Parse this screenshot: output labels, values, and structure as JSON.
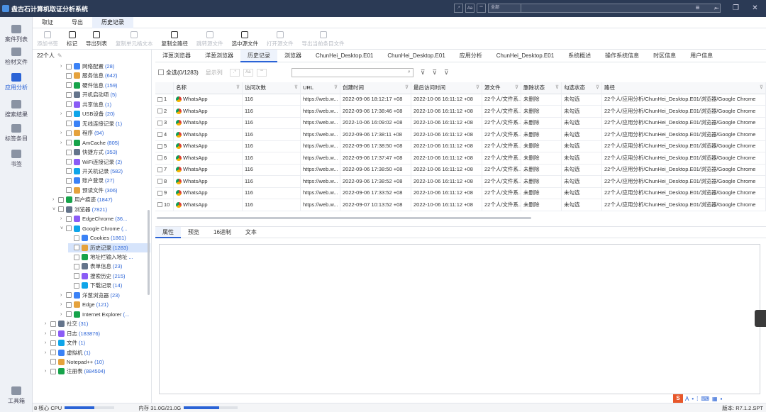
{
  "app": {
    "title": "盘古石计算机取证分析系统",
    "accent": "#2a63d6",
    "titlebar_color": "#2b3a55"
  },
  "titlebar": {
    "btn_a": ".*",
    "btn_b": "Aa",
    "btn_c": "\"\"",
    "search_scope": "全部",
    "search_value": "",
    "search_icon": "search-icon"
  },
  "rail": {
    "items": [
      {
        "label": "案件列表",
        "icon": "case-icon"
      },
      {
        "label": "检材文件",
        "icon": "layers-icon"
      },
      {
        "label": "应用分析",
        "icon": "grid-icon"
      },
      {
        "label": "搜索结果",
        "icon": "document-icon"
      },
      {
        "label": "标签条目",
        "icon": "tag-icon"
      },
      {
        "label": "书签",
        "icon": "bookmark-icon"
      },
      {
        "label": "工具箱",
        "icon": "toolbox-icon"
      }
    ]
  },
  "menu": {
    "items": [
      "取证",
      "导出",
      "历史记录"
    ],
    "active": "历史记录"
  },
  "toolbar": {
    "items": [
      {
        "label": "添加书签",
        "disabled": true
      },
      {
        "label": "标记",
        "disabled": false
      },
      {
        "label": "导出列表",
        "disabled": false
      },
      {
        "label": "复制单元格文本",
        "disabled": true
      },
      {
        "label": "复制全路径",
        "disabled": false
      },
      {
        "label": "跳转源文件",
        "disabled": true
      },
      {
        "label": "选中源文件",
        "disabled": false
      },
      {
        "label": "打开源文件",
        "disabled": true
      },
      {
        "label": "导出当前条目文件",
        "disabled": true
      }
    ]
  },
  "tree": {
    "header": "22个人",
    "nodes": [
      {
        "label": "网络配置",
        "count": "(28)",
        "indent": 3,
        "arrow": "›"
      },
      {
        "label": "服务信息",
        "count": "(642)",
        "indent": 3,
        "arrow": ""
      },
      {
        "label": "硬件信息",
        "count": "(159)",
        "indent": 3,
        "arrow": ""
      },
      {
        "label": "开机启动项",
        "count": "(5)",
        "indent": 3,
        "arrow": ""
      },
      {
        "label": "共享信息",
        "count": "(1)",
        "indent": 3,
        "arrow": ""
      },
      {
        "label": "USB设备",
        "count": "(20)",
        "indent": 3,
        "arrow": "›"
      },
      {
        "label": "无线连接记录",
        "count": "(1)",
        "indent": 3,
        "arrow": ""
      },
      {
        "label": "程序",
        "count": "(94)",
        "indent": 3,
        "arrow": "›"
      },
      {
        "label": "AmCache",
        "count": "(805)",
        "indent": 3,
        "arrow": "›"
      },
      {
        "label": "快捷方式",
        "count": "(353)",
        "indent": 3,
        "arrow": ""
      },
      {
        "label": "WiFi连接记录",
        "count": "(2)",
        "indent": 3,
        "arrow": ""
      },
      {
        "label": "开关机记录",
        "count": "(582)",
        "indent": 3,
        "arrow": ""
      },
      {
        "label": "账户登录",
        "count": "(27)",
        "indent": 3,
        "arrow": ""
      },
      {
        "label": "预读文件",
        "count": "(306)",
        "indent": 3,
        "arrow": ""
      },
      {
        "label": "用户痕迹",
        "count": "(1847)",
        "indent": 2,
        "arrow": "›"
      },
      {
        "label": "浏览器",
        "count": "(7821)",
        "indent": 2,
        "arrow": "˅"
      },
      {
        "label": "EdgeChrome",
        "count": "(36...",
        "indent": 3,
        "arrow": "›"
      },
      {
        "label": "Google Chrome",
        "count": "(...",
        "indent": 3,
        "arrow": "˅"
      },
      {
        "label": "Cookies",
        "count": "(1861)",
        "indent": 4,
        "arrow": ""
      },
      {
        "label": "历史记录",
        "count": "(1283)",
        "indent": 4,
        "arrow": "",
        "selected": true
      },
      {
        "label": "地址栏输入地址",
        "count": "...",
        "indent": 4,
        "arrow": ""
      },
      {
        "label": "表单信息",
        "count": "(23)",
        "indent": 4,
        "arrow": ""
      },
      {
        "label": "搜索历史",
        "count": "(215)",
        "indent": 4,
        "arrow": ""
      },
      {
        "label": "下载记录",
        "count": "(14)",
        "indent": 4,
        "arrow": ""
      },
      {
        "label": "洋葱浏览器",
        "count": "(23)",
        "indent": 3,
        "arrow": "›"
      },
      {
        "label": "Edge",
        "count": "(121)",
        "indent": 3,
        "arrow": "›"
      },
      {
        "label": "Internet Explorer",
        "count": "(...",
        "indent": 3,
        "arrow": "›"
      },
      {
        "label": "社交",
        "count": "(31)",
        "indent": 1,
        "arrow": "›"
      },
      {
        "label": "日志",
        "count": "(183876)",
        "indent": 1,
        "arrow": "›"
      },
      {
        "label": "文件",
        "count": "(1)",
        "indent": 1,
        "arrow": "›"
      },
      {
        "label": "虚拟机",
        "count": "(1)",
        "indent": 1,
        "arrow": "›"
      },
      {
        "label": "Notepad++",
        "count": "(10)",
        "indent": 1,
        "arrow": ""
      },
      {
        "label": "注册表",
        "count": "(884504)",
        "indent": 1,
        "arrow": "›"
      }
    ]
  },
  "tabs": {
    "items": [
      "洋葱浏览器",
      "洋葱浏览器",
      "历史记录",
      "浏览器",
      "ChunHei_Desktop.E01",
      "ChunHei_Desktop.E01",
      "应用分析",
      "ChunHei_Desktop.E01",
      "系统概述",
      "操作系统信息",
      "时区信息",
      "用户信息"
    ],
    "active_index": 2
  },
  "filterbar": {
    "select_all": "全选(0/1283)",
    "show_cols": "显示列",
    "search_value": ""
  },
  "grid": {
    "columns": [
      "名称",
      "访问次数",
      "URL",
      "创建时间",
      "最后访问时间",
      "源文件",
      "删除状态",
      "勾选状态",
      "路径"
    ],
    "rows": [
      {
        "n": "1",
        "name": "WhatsApp",
        "visits": "116",
        "url": "https://web.w...",
        "created": "2022-09-06 18:12:17 +08",
        "last": "2022-10-06 16:11:12 +08",
        "src": "22个人/文件系...",
        "del": "未删除",
        "chk": "未勾选",
        "path": "22个人/应用分析/ChunHei_Desktop.E01/浏览器/Google Chrome"
      },
      {
        "n": "2",
        "name": "WhatsApp",
        "visits": "116",
        "url": "https://web.w...",
        "created": "2022-09-06 17:38:46 +08",
        "last": "2022-10-06 16:11:12 +08",
        "src": "22个人/文件系...",
        "del": "未删除",
        "chk": "未勾选",
        "path": "22个人/应用分析/ChunHei_Desktop.E01/浏览器/Google Chrome"
      },
      {
        "n": "3",
        "name": "WhatsApp",
        "visits": "116",
        "url": "https://web.w...",
        "created": "2022-10-06 16:09:02 +08",
        "last": "2022-10-06 16:11:12 +08",
        "src": "22个人/文件系...",
        "del": "未删除",
        "chk": "未勾选",
        "path": "22个人/应用分析/ChunHei_Desktop.E01/浏览器/Google Chrome"
      },
      {
        "n": "4",
        "name": "WhatsApp",
        "visits": "116",
        "url": "https://web.w...",
        "created": "2022-09-06 17:38:11 +08",
        "last": "2022-10-06 16:11:12 +08",
        "src": "22个人/文件系...",
        "del": "未删除",
        "chk": "未勾选",
        "path": "22个人/应用分析/ChunHei_Desktop.E01/浏览器/Google Chrome"
      },
      {
        "n": "5",
        "name": "WhatsApp",
        "visits": "116",
        "url": "https://web.w...",
        "created": "2022-09-06 17:38:50 +08",
        "last": "2022-10-06 16:11:12 +08",
        "src": "22个人/文件系...",
        "del": "未删除",
        "chk": "未勾选",
        "path": "22个人/应用分析/ChunHei_Desktop.E01/浏览器/Google Chrome"
      },
      {
        "n": "6",
        "name": "WhatsApp",
        "visits": "116",
        "url": "https://web.w...",
        "created": "2022-09-06 17:37:47 +08",
        "last": "2022-10-06 16:11:12 +08",
        "src": "22个人/文件系...",
        "del": "未删除",
        "chk": "未勾选",
        "path": "22个人/应用分析/ChunHei_Desktop.E01/浏览器/Google Chrome"
      },
      {
        "n": "7",
        "name": "WhatsApp",
        "visits": "116",
        "url": "https://web.w...",
        "created": "2022-09-06 17:38:50 +08",
        "last": "2022-10-06 16:11:12 +08",
        "src": "22个人/文件系...",
        "del": "未删除",
        "chk": "未勾选",
        "path": "22个人/应用分析/ChunHei_Desktop.E01/浏览器/Google Chrome"
      },
      {
        "n": "8",
        "name": "WhatsApp",
        "visits": "116",
        "url": "https://web.w...",
        "created": "2022-09-06 17:38:52 +08",
        "last": "2022-10-06 16:11:12 +08",
        "src": "22个人/文件系...",
        "del": "未删除",
        "chk": "未勾选",
        "path": "22个人/应用分析/ChunHei_Desktop.E01/浏览器/Google Chrome"
      },
      {
        "n": "9",
        "name": "WhatsApp",
        "visits": "116",
        "url": "https://web.w...",
        "created": "2022-09-06 17:33:52 +08",
        "last": "2022-10-06 16:11:12 +08",
        "src": "22个人/文件系...",
        "del": "未删除",
        "chk": "未勾选",
        "path": "22个人/应用分析/ChunHei_Desktop.E01/浏览器/Google Chrome"
      },
      {
        "n": "10",
        "name": "WhatsApp",
        "visits": "116",
        "url": "https://web.w...",
        "created": "2022-09-07 10:13:52 +08",
        "last": "2022-10-06 16:11:12 +08",
        "src": "22个人/文件系...",
        "del": "未删除",
        "chk": "未勾选",
        "path": "22个人/应用分析/ChunHei_Desktop.E01/浏览器/Google Chrome"
      }
    ]
  },
  "detail": {
    "tabs": [
      "属性",
      "预览",
      "16进制",
      "文本"
    ],
    "active": "属性"
  },
  "status": {
    "cores": "8 核心 CPU",
    "cpu_fraction": 0.6,
    "mem": "内存 31.0G/21.0G",
    "mem_fraction": 0.65,
    "version": "版本: R7.1.2.SPT"
  },
  "ime": {
    "label": "S",
    "items": [
      "A",
      "•",
      "⁞",
      "⌨",
      "▦",
      "▪"
    ]
  }
}
